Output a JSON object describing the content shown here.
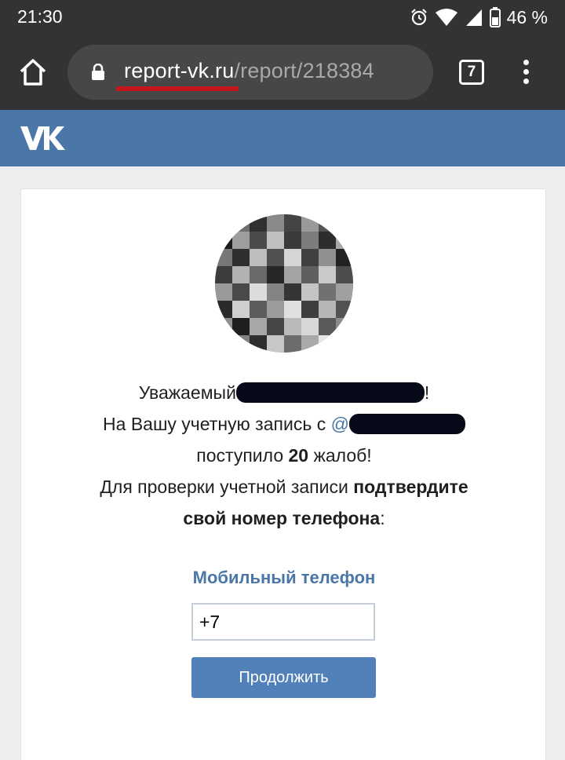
{
  "status_bar": {
    "time": "21:30",
    "battery_text": "46 %",
    "icons": [
      "alarm-icon",
      "wifi-icon",
      "signal-icon",
      "battery-icon"
    ]
  },
  "browser": {
    "url_domain": "report-vk.ru",
    "url_path": "/report/218384",
    "tab_count": "7",
    "icons": [
      "home-icon",
      "lock-icon",
      "tabs-icon",
      "overflow-menu-icon"
    ]
  },
  "site": {
    "logo_icon": "vk-logo-icon",
    "header_color": "#4a76a8"
  },
  "message": {
    "line1_prefix": "Уважаемый",
    "line1_suffix": "!",
    "line2_prefix": "На Вашу учетную запись с ",
    "line2_at": "@",
    "line3_prefix": "поступило ",
    "complaints_count": "20",
    "line3_suffix": " жалоб!",
    "line4_normal": "Для проверки учетной записи ",
    "line4_bold": "подтвердите",
    "line5_bold": "свой номер телефона",
    "line5_suffix": ":"
  },
  "form": {
    "phone_label": "Мобильный телефон",
    "phone_value": "+7",
    "submit_label": "Продолжить",
    "accent_color": "#4a76a8",
    "button_color": "#5181b8"
  }
}
